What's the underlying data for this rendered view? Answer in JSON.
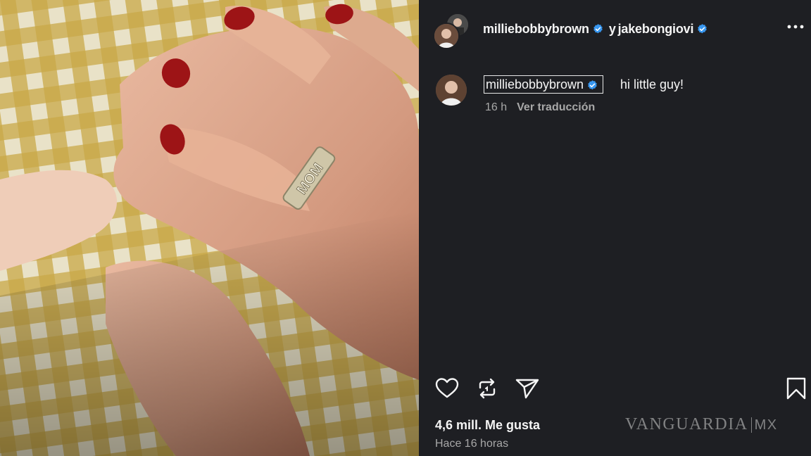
{
  "post": {
    "author1": "milliebobbybrown",
    "conjunction": "y",
    "author2": "jakebongiovi"
  },
  "comment": {
    "username": "milliebobbybrown",
    "text": "hi little guy!",
    "time_ago": "16 h",
    "translate_label": "Ver traducción"
  },
  "engagement": {
    "likes": "4,6 mill. Me gusta",
    "posted": "Hace 16 horas"
  },
  "watermark": {
    "brand": "VANGUARDIA",
    "region": "MX"
  },
  "icons": {
    "verified": "verified-badge-icon",
    "more": "more-options-icon",
    "like": "heart-icon",
    "repost": "repost-icon",
    "share": "send-icon",
    "save": "bookmark-icon"
  },
  "colors": {
    "verified_blue": "#3897f0",
    "panel_bg": "#1e1f23"
  }
}
